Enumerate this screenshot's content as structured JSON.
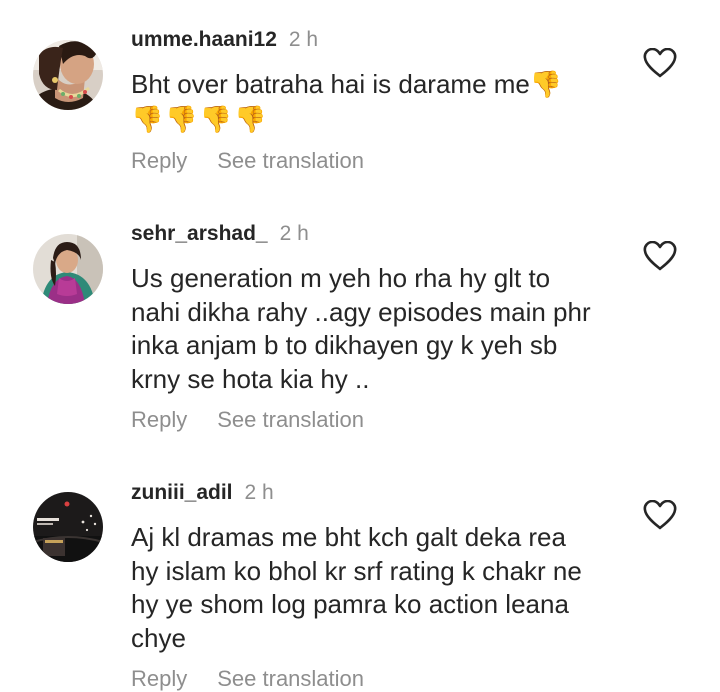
{
  "comments": [
    {
      "username": "umme.haani12",
      "time": "2 h",
      "text": "Bht over batraha hai is darame me",
      "trailing_emoji": "👎",
      "emoji_row": "👎👎👎👎",
      "reply_label": "Reply",
      "translate_label": "See translation",
      "like_icon": "heart-outline-icon"
    },
    {
      "username": "sehr_arshad_",
      "time": "2 h",
      "text_lines": [
        "Us generation m yeh ho rha hy glt to",
        "nahi dikha rahy ..agy episodes main phr",
        "inka anjam b to dikhayen gy k yeh sb",
        "krny se hota kia hy .."
      ],
      "reply_label": "Reply",
      "translate_label": "See translation",
      "like_icon": "heart-outline-icon"
    },
    {
      "username": "zuniii_adil",
      "time": "2 h",
      "text_lines": [
        "Aj kl dramas me bht kch galt deka rea",
        "hy islam ko bhol kr srf rating k chakr ne",
        "hy ye shom log pamra ko action leana",
        "chye"
      ],
      "reply_label": "Reply",
      "translate_label": "See translation",
      "like_icon": "heart-outline-icon"
    }
  ],
  "colors": {
    "text_primary": "#262626",
    "text_secondary": "#8e8e8e"
  }
}
